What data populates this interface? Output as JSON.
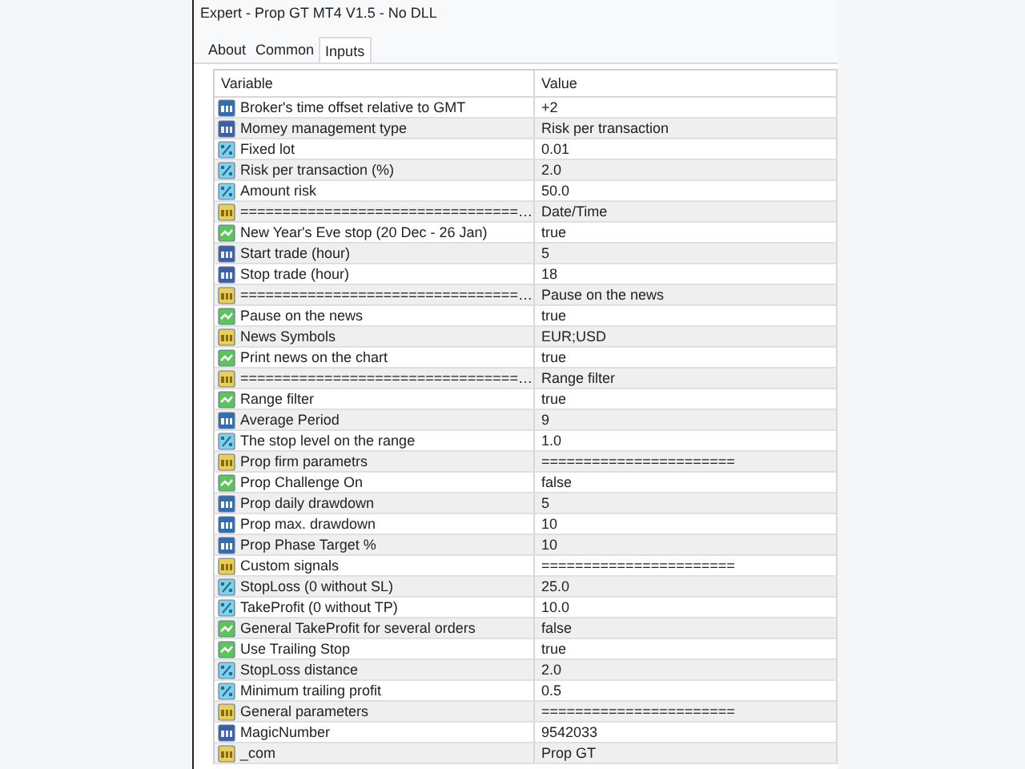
{
  "window": {
    "title": "Expert - Prop GT MT4 V1.5 - No DLL"
  },
  "tabs": [
    {
      "label": "About",
      "selected": false
    },
    {
      "label": "Common",
      "selected": false
    },
    {
      "label": "Inputs",
      "selected": true
    }
  ],
  "table": {
    "columns": [
      "Variable",
      "Value"
    ],
    "rows": [
      {
        "kind": "int",
        "variable": "Broker's time offset relative to GMT",
        "value": "+2"
      },
      {
        "kind": "enum",
        "variable": "Momey management type",
        "value": "Risk per transaction"
      },
      {
        "kind": "double",
        "variable": "Fixed lot",
        "value": "0.01"
      },
      {
        "kind": "double",
        "variable": "Risk per transaction (%)",
        "value": "2.0"
      },
      {
        "kind": "double",
        "variable": "Amount risk",
        "value": "50.0"
      },
      {
        "kind": "string",
        "variable": "=================================…",
        "value": "Date/Time"
      },
      {
        "kind": "bool",
        "variable": "New Year's Eve stop (20 Dec - 26 Jan)",
        "value": "true"
      },
      {
        "kind": "enum",
        "variable": "Start trade (hour)",
        "value": "5"
      },
      {
        "kind": "enum",
        "variable": "Stop trade (hour)",
        "value": "18"
      },
      {
        "kind": "string",
        "variable": "=================================…",
        "value": "Pause on the news"
      },
      {
        "kind": "bool",
        "variable": "Pause on the news",
        "value": "true"
      },
      {
        "kind": "string",
        "variable": "News Symbols",
        "value": "EUR;USD"
      },
      {
        "kind": "bool",
        "variable": "Print news on the chart",
        "value": "true"
      },
      {
        "kind": "string",
        "variable": "=================================…",
        "value": "Range filter"
      },
      {
        "kind": "bool",
        "variable": "Range filter",
        "value": "true"
      },
      {
        "kind": "int",
        "variable": "Average Period",
        "value": "9"
      },
      {
        "kind": "double",
        "variable": "The stop level on the range",
        "value": "1.0"
      },
      {
        "kind": "string",
        "variable": "Prop firm parametrs",
        "value": "======================="
      },
      {
        "kind": "bool",
        "variable": "Prop Challenge On",
        "value": "false"
      },
      {
        "kind": "int",
        "variable": "Prop daily drawdown",
        "value": "5"
      },
      {
        "kind": "int",
        "variable": "Prop max. drawdown",
        "value": "10"
      },
      {
        "kind": "int",
        "variable": "Prop Phase Target %",
        "value": "10"
      },
      {
        "kind": "string",
        "variable": "Custom signals",
        "value": "======================="
      },
      {
        "kind": "double",
        "variable": "StopLoss (0 without SL)",
        "value": "25.0"
      },
      {
        "kind": "double",
        "variable": "TakeProfit (0 without TP)",
        "value": "10.0"
      },
      {
        "kind": "bool",
        "variable": "General TakeProfit for several orders",
        "value": "false"
      },
      {
        "kind": "bool",
        "variable": "Use Trailing Stop",
        "value": "true"
      },
      {
        "kind": "double",
        "variable": "StopLoss distance",
        "value": "2.0"
      },
      {
        "kind": "double",
        "variable": "Minimum trailing profit",
        "value": "0.5"
      },
      {
        "kind": "string",
        "variable": "General parameters",
        "value": "======================="
      },
      {
        "kind": "enum",
        "variable": "MagicNumber",
        "value": "9542033"
      },
      {
        "kind": "string",
        "variable": "_com",
        "value": "Prop GT"
      }
    ]
  }
}
